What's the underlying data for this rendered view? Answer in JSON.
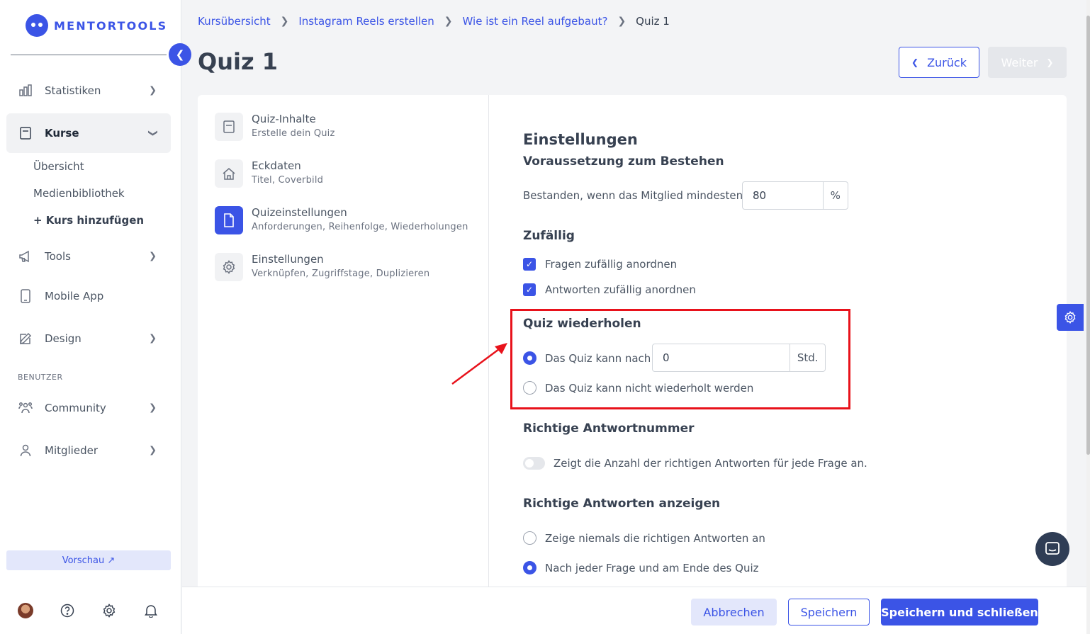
{
  "brand": {
    "name": "MENTORTOOLS",
    "color": "#3b54e6"
  },
  "sidebar": {
    "items": [
      {
        "label": "Statistiken",
        "icon": "bar-chart-icon"
      },
      {
        "label": "Kurse",
        "icon": "book-icon"
      },
      {
        "label": "Tools",
        "icon": "megaphone-icon"
      },
      {
        "label": "Mobile App",
        "icon": "phone-icon"
      },
      {
        "label": "Design",
        "icon": "pencil-icon"
      },
      {
        "label": "Community",
        "icon": "community-icon"
      },
      {
        "label": "Mitglieder",
        "icon": "user-icon"
      }
    ],
    "subitems": [
      "Übersicht",
      "Medienbibliothek",
      "+ Kurs hinzufügen"
    ],
    "section_label": "BENUTZER",
    "preview_label": "Vorschau ↗"
  },
  "breadcrumb": [
    "Kursübersicht",
    "Instagram Reels erstellen",
    "Wie ist ein Reel aufgebaut?",
    "Quiz 1"
  ],
  "page_title": "Quiz 1",
  "nav_buttons": {
    "back": "Zurück",
    "next": "Weiter"
  },
  "steps": [
    {
      "title": "Quiz-Inhalte",
      "subtitle": "Erstelle dein Quiz",
      "icon": "book-icon"
    },
    {
      "title": "Eckdaten",
      "subtitle": "Titel, Coverbild",
      "icon": "home-icon"
    },
    {
      "title": "Quizeinstellungen",
      "subtitle": "Anforderungen, Reihenfolge, Wiederholungen",
      "icon": "document-icon"
    },
    {
      "title": "Einstellungen",
      "subtitle": "Verknüpfen, Zugriffstage, Duplizieren",
      "icon": "gear-icon"
    }
  ],
  "settings": {
    "title": "Einstellungen",
    "passing": {
      "heading": "Voraussetzung zum Bestehen",
      "label": "Bestanden, wenn das Mitglied mindestens",
      "value": "80",
      "unit": "%"
    },
    "random": {
      "heading": "Zufällig",
      "options": [
        {
          "label": "Fragen zufällig anordnen",
          "checked": true
        },
        {
          "label": "Antworten zufällig anordnen",
          "checked": true
        }
      ]
    },
    "repeat": {
      "heading": "Quiz wiederholen",
      "option_after": "Das Quiz kann nach",
      "after_value": "0",
      "after_unit": "Std.",
      "option_never": "Das Quiz kann nicht wiederholt werden",
      "selected": "after"
    },
    "answer_number": {
      "heading": "Richtige Antwortnummer",
      "toggle_label": "Zeigt die Anzahl der richtigen Antworten für jede Frage an.",
      "enabled": false
    },
    "show_answers": {
      "heading": "Richtige Antworten anzeigen",
      "options": [
        "Zeige niemals die richtigen Antworten an",
        "Nach jeder Frage und am Ende des Quiz"
      ],
      "selected_index": 1
    }
  },
  "footer": {
    "cancel": "Abbrechen",
    "save": "Speichern",
    "save_close": "Speichern und schließen"
  },
  "annotation_color": "#e8121b"
}
